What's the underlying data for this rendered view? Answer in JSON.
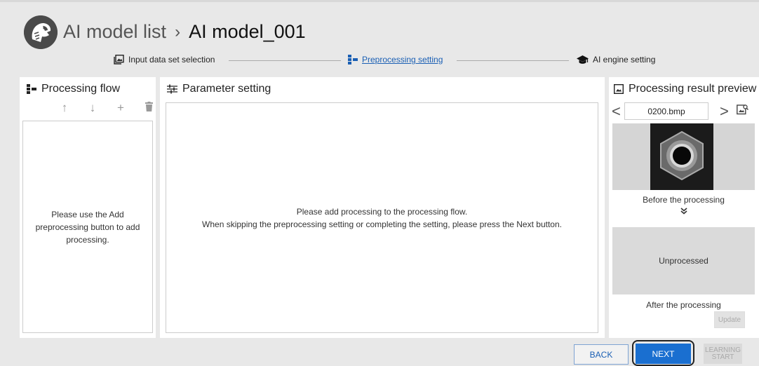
{
  "header": {
    "breadcrumb_root": "AI model list",
    "breadcrumb_separator": "›",
    "breadcrumb_current": "AI model_001"
  },
  "stepper": {
    "steps": [
      {
        "label": "Input data set selection",
        "icon": "image-set-icon",
        "active": false
      },
      {
        "label": "Preprocessing setting",
        "icon": "flow-icon",
        "active": true
      },
      {
        "label": "AI engine setting",
        "icon": "graduation-cap-icon",
        "active": false
      }
    ]
  },
  "processing_flow": {
    "title": "Processing flow",
    "toolbar": {
      "up": "↑",
      "down": "↓",
      "add": "+",
      "delete": "trash-icon"
    },
    "empty_message": "Please use the Add preprocessing button to add processing."
  },
  "parameter_setting": {
    "title": "Parameter setting",
    "message_line1": "Please add processing to the processing flow.",
    "message_line2": "When skipping the preprocessing setting or completing the setting, please press the Next button."
  },
  "preview": {
    "title": "Processing result preview",
    "prev": "<",
    "next": ">",
    "file_name": "0200.bmp",
    "before_label": "Before the processing",
    "chevron": "»",
    "after_placeholder": "Unprocessed",
    "after_label": "After the processing",
    "update_label": "Update"
  },
  "footer": {
    "back_label": "BACK",
    "next_label": "NEXT",
    "learning_label_1": "LEARNING",
    "learning_label_2": "START"
  },
  "colors": {
    "accent": "#1a6fd0",
    "link": "#1a5fb4",
    "background": "#e8e8e8"
  }
}
